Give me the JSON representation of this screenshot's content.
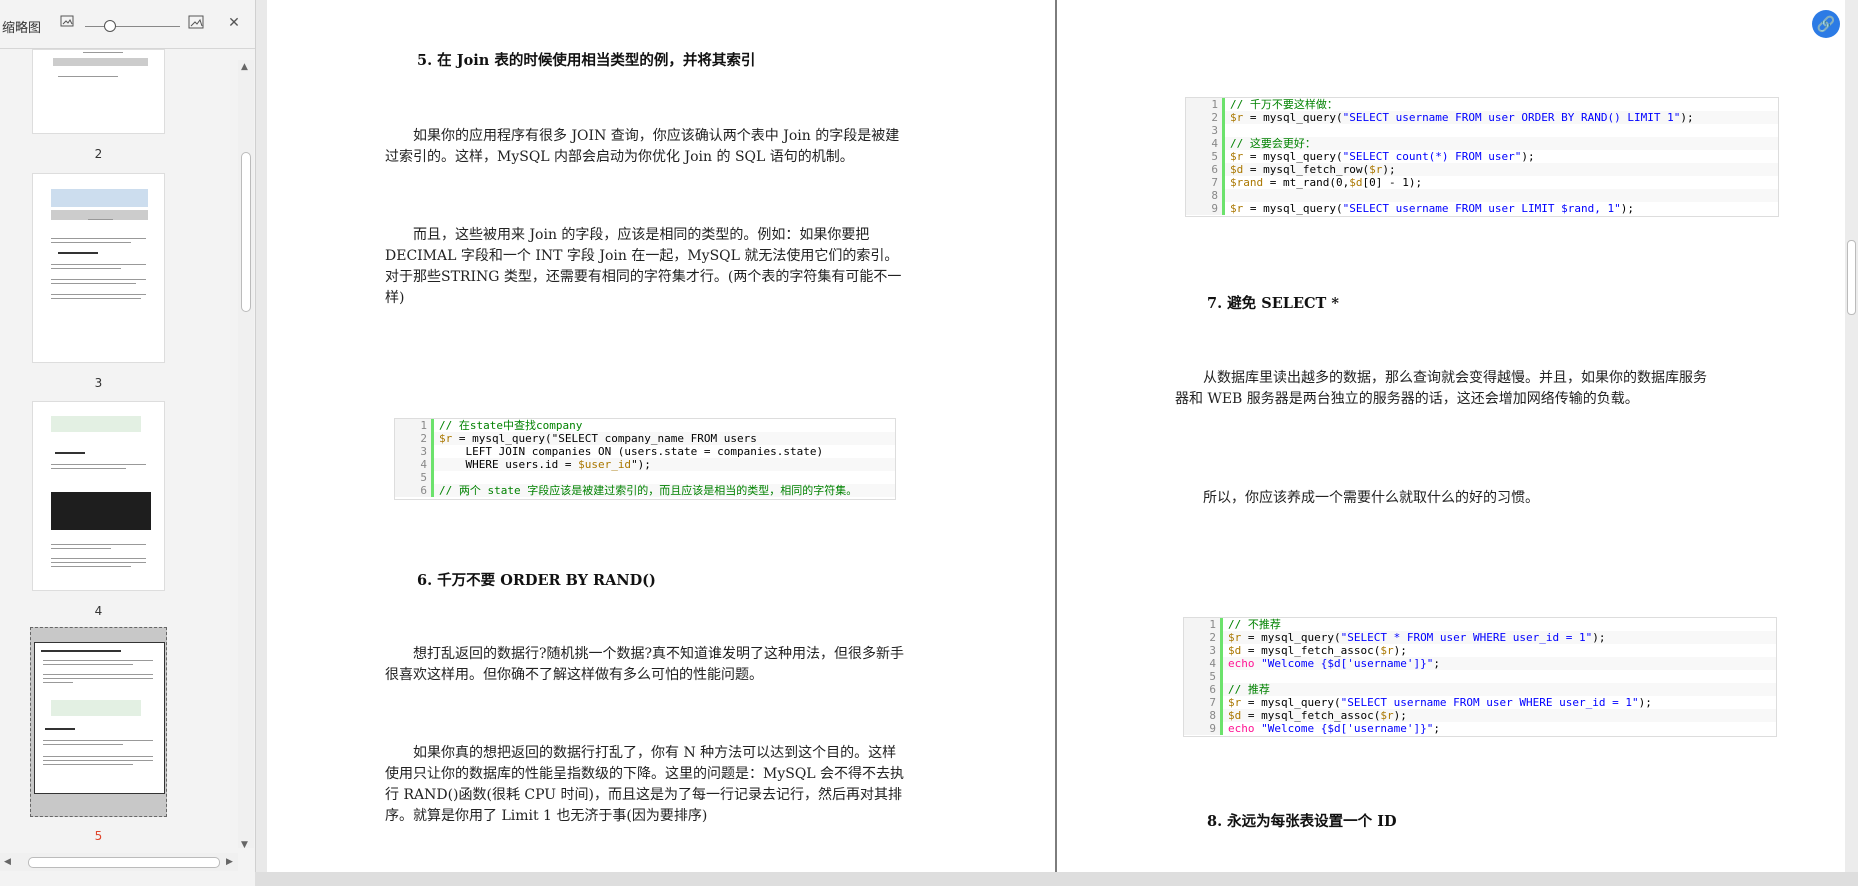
{
  "sidebar": {
    "title": "缩略图",
    "icons": [
      "image-small-icon",
      "image-large-icon",
      "close-icon"
    ],
    "thumbnails": [
      {
        "label": "2"
      },
      {
        "label": "3"
      },
      {
        "label": "4"
      },
      {
        "label": "5"
      }
    ]
  },
  "left_page": {
    "heading5": "5. 在 Join 表的时候使用相当类型的例，并将其索引",
    "p1": "如果你的应用程序有很多 JOIN 查询，你应该确认两个表中 Join 的字段是被建过索引的。这样，MySQL 内部会启动为你优化 Join 的 SQL 语句的机制。",
    "p2": "而且，这些被用来 Join 的字段，应该是相同的类型的。例如：如果你要把 DECIMAL 字段和一个 INT 字段 Join 在一起，MySQL 就无法使用它们的索引。对于那些STRING 类型，还需要有相同的字符集才行。(两个表的字符集有可能不一样)",
    "code1": [
      {
        "n": "1",
        "t": "// 在state中查找company"
      },
      {
        "n": "2",
        "t": "$r = mysql_query(\"SELECT company_name FROM users"
      },
      {
        "n": "3",
        "t": "    LEFT JOIN companies ON (users.state = companies.state)"
      },
      {
        "n": "4",
        "t": "    WHERE users.id = $user_id\");"
      },
      {
        "n": "5",
        "t": ""
      },
      {
        "n": "6",
        "t": "// 两个 state 字段应该是被建过索引的，而且应该是相当的类型，相同的字符集。"
      }
    ],
    "heading6": "6. 千万不要 ORDER BY RAND()",
    "p3": "想打乱返回的数据行?随机挑一个数据?真不知道谁发明了这种用法，但很多新手很喜欢这样用。但你确不了解这样做有多么可怕的性能问题。",
    "p4": "如果你真的想把返回的数据行打乱了，你有 N 种方法可以达到这个目的。这样使用只让你的数据库的性能呈指数级的下降。这里的问题是：MySQL 会不得不去执行 RAND()函数(很耗 CPU 时间)，而且这是为了每一行记录去记行，然后再对其排序。就算是你用了 Limit 1 也无济于事(因为要排序)"
  },
  "right_page": {
    "code2": [
      {
        "n": "1",
        "t": "// 千万不要这样做："
      },
      {
        "n": "2",
        "t": "$r = mysql_query(\"SELECT username FROM user ORDER BY RAND() LIMIT 1\");"
      },
      {
        "n": "3",
        "t": ""
      },
      {
        "n": "4",
        "t": "// 这要会更好："
      },
      {
        "n": "5",
        "t": "$r = mysql_query(\"SELECT count(*) FROM user\");"
      },
      {
        "n": "6",
        "t": "$d = mysql_fetch_row($r);"
      },
      {
        "n": "7",
        "t": "$rand = mt_rand(0,$d[0] - 1);"
      },
      {
        "n": "8",
        "t": ""
      },
      {
        "n": "9",
        "t": "$r = mysql_query(\"SELECT username FROM user LIMIT $rand, 1\");"
      }
    ],
    "heading7": "7. 避免 SELECT *",
    "p5": "从数据库里读出越多的数据，那么查询就会变得越慢。并且，如果你的数据库服务器和 WEB 服务器是两台独立的服务器的话，这还会增加网络传输的负载。",
    "p6": "所以，你应该养成一个需要什么就取什么的好的习惯。",
    "code3": [
      {
        "n": "1",
        "t": "// 不推荐"
      },
      {
        "n": "2",
        "t": "$r = mysql_query(\"SELECT * FROM user WHERE user_id = 1\");"
      },
      {
        "n": "3",
        "t": "$d = mysql_fetch_assoc($r);"
      },
      {
        "n": "4",
        "t": "echo \"Welcome {$d['username']}\";"
      },
      {
        "n": "5",
        "t": ""
      },
      {
        "n": "6",
        "t": "// 推荐"
      },
      {
        "n": "7",
        "t": "$r = mysql_query(\"SELECT username FROM user WHERE user_id = 1\");"
      },
      {
        "n": "8",
        "t": "$d = mysql_fetch_assoc($r);"
      },
      {
        "n": "9",
        "t": "echo \"Welcome {$d['username']}\";"
      }
    ],
    "heading8": "8. 永远为每张表设置一个 ID"
  },
  "colors": {
    "accent": "#2c7be5",
    "code_bar": "#6ce26c",
    "active_label": "#e0452b"
  }
}
